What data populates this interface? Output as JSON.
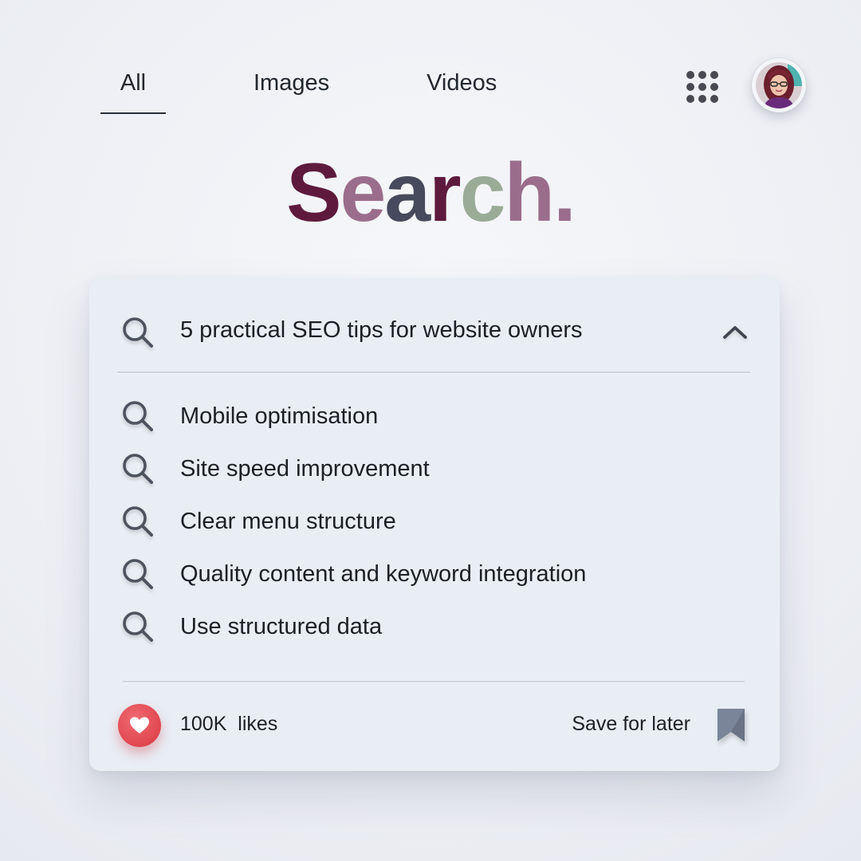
{
  "tabs": [
    {
      "label": "All",
      "active": true
    },
    {
      "label": "Images",
      "active": false
    },
    {
      "label": "Videos",
      "active": false
    }
  ],
  "header": {
    "apps_icon": "apps-grid-icon",
    "avatar": "user-avatar"
  },
  "logo": {
    "letters": [
      {
        "char": "S",
        "color": "#5e1a3d"
      },
      {
        "char": "e",
        "color": "#9b6d8c"
      },
      {
        "char": "a",
        "color": "#474a5c"
      },
      {
        "char": "r",
        "color": "#5e1a3d"
      },
      {
        "char": "c",
        "color": "#9aac97"
      },
      {
        "char": "h",
        "color": "#9b6d8c"
      },
      {
        "char": ".",
        "color": "#9b6d8c"
      }
    ]
  },
  "search": {
    "query": "5 practical SEO tips for website owners",
    "collapse_icon": "chevron-up-icon"
  },
  "suggestions": [
    "Mobile optimisation",
    "Site speed improvement",
    "Clear menu structure",
    "Quality content and keyword integration",
    "Use structured data"
  ],
  "footer": {
    "likes": "100K  likes",
    "save_label": "Save for later",
    "like_icon": "heart-icon",
    "bookmark_icon": "bookmark-icon"
  },
  "colors": {
    "accent_red": "#e0474f",
    "bookmark": "#7b8599",
    "card_bg": "#e9edf4"
  }
}
